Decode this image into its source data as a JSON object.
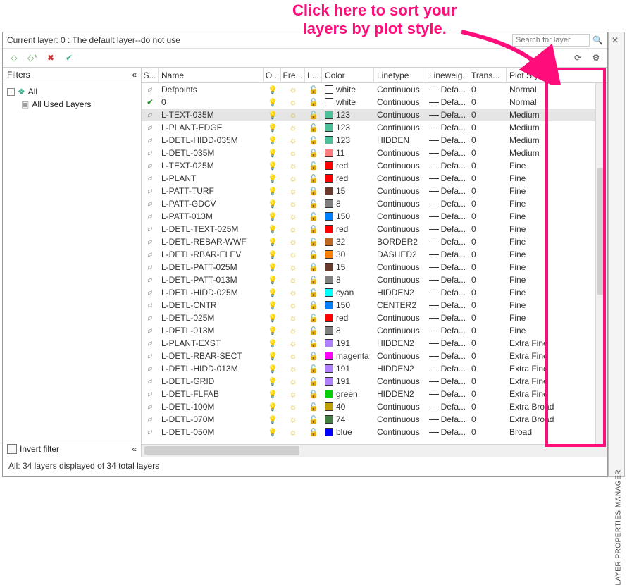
{
  "callout": "Click here to sort your\nlayers by plot style.",
  "panel": {
    "title": "LAYER PROPERTIES MANAGER"
  },
  "top": {
    "current_layer": "Current layer: 0 : The default layer--do not use",
    "search_placeholder": "Search for layer"
  },
  "filters": {
    "header": "Filters",
    "collapse": "«",
    "tree_all": "All",
    "tree_used": "All Used Layers",
    "invert": "Invert filter"
  },
  "columns": {
    "status": "S...",
    "name": "Name",
    "on": "O...",
    "freeze": "Fre...",
    "lock": "L...",
    "color": "Color",
    "linetype": "Linetype",
    "lineweight": "Lineweig...",
    "transparency": "Trans...",
    "plot": "Plot Style"
  },
  "rows": [
    {
      "status": "leaf",
      "name": "Defpoints",
      "color": "white",
      "swatch": "#ffffff",
      "linetype": "Continuous",
      "lw": "Defa...",
      "tr": "0",
      "plot": "Normal"
    },
    {
      "status": "check",
      "name": "0",
      "color": "white",
      "swatch": "#ffffff",
      "linetype": "Continuous",
      "lw": "Defa...",
      "tr": "0",
      "plot": "Normal"
    },
    {
      "status": "leaf",
      "name": "L-TEXT-035M",
      "color": "123",
      "swatch": "#4cbf9b",
      "linetype": "Continuous",
      "lw": "Defa...",
      "tr": "0",
      "plot": "Medium",
      "selected": true
    },
    {
      "status": "leaf",
      "name": "L-PLANT-EDGE",
      "color": "123",
      "swatch": "#4cbf9b",
      "linetype": "Continuous",
      "lw": "Defa...",
      "tr": "0",
      "plot": "Medium"
    },
    {
      "status": "leaf",
      "name": "L-DETL-HIDD-035M",
      "color": "123",
      "swatch": "#4cbf9b",
      "linetype": "HIDDEN",
      "lw": "Defa...",
      "tr": "0",
      "plot": "Medium"
    },
    {
      "status": "leaf",
      "name": "L-DETL-035M",
      "color": "11",
      "swatch": "#ff7d7d",
      "linetype": "Continuous",
      "lw": "Defa...",
      "tr": "0",
      "plot": "Medium"
    },
    {
      "status": "leaf",
      "name": "L-TEXT-025M",
      "color": "red",
      "swatch": "#ff0000",
      "linetype": "Continuous",
      "lw": "Defa...",
      "tr": "0",
      "plot": "Fine"
    },
    {
      "status": "leaf",
      "name": "L-PLANT",
      "color": "red",
      "swatch": "#ff0000",
      "linetype": "Continuous",
      "lw": "Defa...",
      "tr": "0",
      "plot": "Fine"
    },
    {
      "status": "leaf",
      "name": "L-PATT-TURF",
      "color": "15",
      "swatch": "#6a3a2a",
      "linetype": "Continuous",
      "lw": "Defa...",
      "tr": "0",
      "plot": "Fine"
    },
    {
      "status": "leaf",
      "name": "L-PATT-GDCV",
      "color": "8",
      "swatch": "#808080",
      "linetype": "Continuous",
      "lw": "Defa...",
      "tr": "0",
      "plot": "Fine"
    },
    {
      "status": "leaf",
      "name": "L-PATT-013M",
      "color": "150",
      "swatch": "#0080ff",
      "linetype": "Continuous",
      "lw": "Defa...",
      "tr": "0",
      "plot": "Fine"
    },
    {
      "status": "leaf",
      "name": "L-DETL-TEXT-025M",
      "color": "red",
      "swatch": "#ff0000",
      "linetype": "Continuous",
      "lw": "Defa...",
      "tr": "0",
      "plot": "Fine"
    },
    {
      "status": "leaf",
      "name": "L-DETL-REBAR-WWF",
      "color": "32",
      "swatch": "#c06820",
      "linetype": "BORDER2",
      "lw": "Defa...",
      "tr": "0",
      "plot": "Fine"
    },
    {
      "status": "leaf",
      "name": "L-DETL-RBAR-ELEV",
      "color": "30",
      "swatch": "#ff8000",
      "linetype": "DASHED2",
      "lw": "Defa...",
      "tr": "0",
      "plot": "Fine"
    },
    {
      "status": "leaf",
      "name": "L-DETL-PATT-025M",
      "color": "15",
      "swatch": "#6a3a2a",
      "linetype": "Continuous",
      "lw": "Defa...",
      "tr": "0",
      "plot": "Fine"
    },
    {
      "status": "leaf",
      "name": "L-DETL-PATT-013M",
      "color": "8",
      "swatch": "#808080",
      "linetype": "Continuous",
      "lw": "Defa...",
      "tr": "0",
      "plot": "Fine"
    },
    {
      "status": "leaf",
      "name": "L-DETL-HIDD-025M",
      "color": "cyan",
      "swatch": "#00ffff",
      "linetype": "HIDDEN2",
      "lw": "Defa...",
      "tr": "0",
      "plot": "Fine"
    },
    {
      "status": "leaf",
      "name": "L-DETL-CNTR",
      "color": "150",
      "swatch": "#0080ff",
      "linetype": "CENTER2",
      "lw": "Defa...",
      "tr": "0",
      "plot": "Fine"
    },
    {
      "status": "leaf",
      "name": "L-DETL-025M",
      "color": "red",
      "swatch": "#ff0000",
      "linetype": "Continuous",
      "lw": "Defa...",
      "tr": "0",
      "plot": "Fine"
    },
    {
      "status": "leaf",
      "name": "L-DETL-013M",
      "color": "8",
      "swatch": "#808080",
      "linetype": "Continuous",
      "lw": "Defa...",
      "tr": "0",
      "plot": "Fine"
    },
    {
      "status": "leaf",
      "name": "L-PLANT-EXST",
      "color": "191",
      "swatch": "#b080ff",
      "linetype": "HIDDEN2",
      "lw": "Defa...",
      "tr": "0",
      "plot": "Extra Fine"
    },
    {
      "status": "leaf",
      "name": "L-DETL-RBAR-SECT",
      "color": "magenta",
      "swatch": "#ff00ff",
      "linetype": "Continuous",
      "lw": "Defa...",
      "tr": "0",
      "plot": "Extra Fine"
    },
    {
      "status": "leaf",
      "name": "L-DETL-HIDD-013M",
      "color": "191",
      "swatch": "#b080ff",
      "linetype": "HIDDEN2",
      "lw": "Defa...",
      "tr": "0",
      "plot": "Extra Fine"
    },
    {
      "status": "leaf",
      "name": "L-DETL-GRID",
      "color": "191",
      "swatch": "#b080ff",
      "linetype": "Continuous",
      "lw": "Defa...",
      "tr": "0",
      "plot": "Extra Fine"
    },
    {
      "status": "leaf",
      "name": "L-DETL-FLFAB",
      "color": "green",
      "swatch": "#00d000",
      "linetype": "HIDDEN2",
      "lw": "Defa...",
      "tr": "0",
      "plot": "Extra Fine"
    },
    {
      "status": "leaf",
      "name": "L-DETL-100M",
      "color": "40",
      "swatch": "#c0a000",
      "linetype": "Continuous",
      "lw": "Defa...",
      "tr": "0",
      "plot": "Extra Broad"
    },
    {
      "status": "leaf",
      "name": "L-DETL-070M",
      "color": "74",
      "swatch": "#408040",
      "linetype": "Continuous",
      "lw": "Defa...",
      "tr": "0",
      "plot": "Extra Broad"
    },
    {
      "status": "leaf",
      "name": "L-DETL-050M",
      "color": "blue",
      "swatch": "#0000ff",
      "linetype": "Continuous",
      "lw": "Defa...",
      "tr": "0",
      "plot": "Broad"
    }
  ],
  "footer": "All: 34 layers displayed of 34 total layers"
}
